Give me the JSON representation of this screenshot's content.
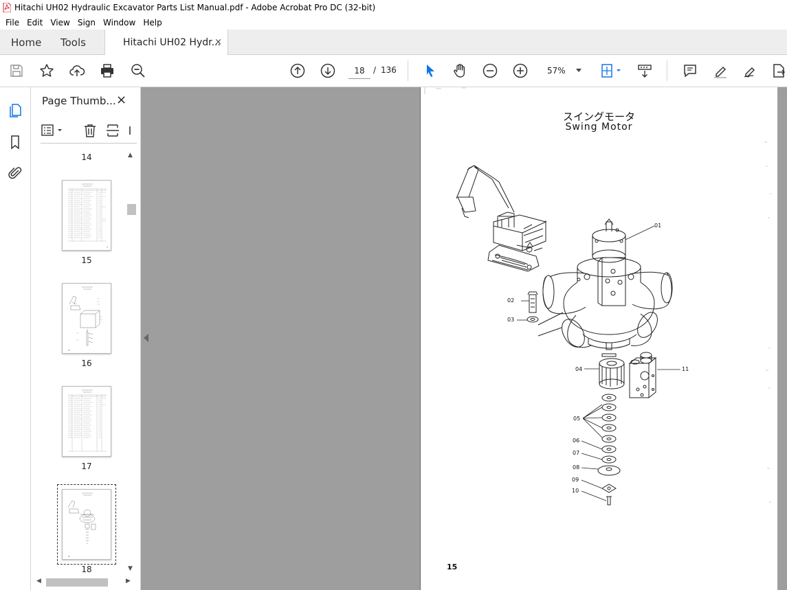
{
  "window": {
    "title": "Hitachi UH02 Hydraulic Excavator Parts List Manual.pdf - Adobe Acrobat Pro DC (32-bit)"
  },
  "menu": [
    "File",
    "Edit",
    "View",
    "Sign",
    "Window",
    "Help"
  ],
  "tabs": {
    "home": "Home",
    "tools": "Tools",
    "document": "Hitachi UH02 Hydr...",
    "close": "×"
  },
  "toolbar": {
    "current_page": "18",
    "page_separator": "/",
    "total_pages": "136",
    "zoom": "57%",
    "icons": [
      "save-icon",
      "star-icon",
      "upload-icon",
      "print-icon",
      "search-zoom-icon",
      "page-up-icon",
      "page-down-icon",
      "select-cursor-icon",
      "hand-icon",
      "zoom-out-icon",
      "zoom-in-icon",
      "fit-page-icon",
      "scroll-mode-icon",
      "comment-icon",
      "highlight-icon",
      "sign-icon",
      "export-icon"
    ],
    "accent": "#1473e6"
  },
  "thumbnail_panel": {
    "title": "Page Thumb...",
    "close": "×",
    "pages": [
      {
        "label": "14"
      },
      {
        "label": "15"
      },
      {
        "label": "16"
      },
      {
        "label": "17"
      },
      {
        "label": "18"
      }
    ]
  },
  "page": {
    "title_jp": "スイングモータ",
    "title_en": "Swing Motor",
    "page_number": "15",
    "callouts": [
      "01",
      "02",
      "03",
      "04",
      "05",
      "06",
      "07",
      "08",
      "09",
      "10",
      "11"
    ]
  }
}
